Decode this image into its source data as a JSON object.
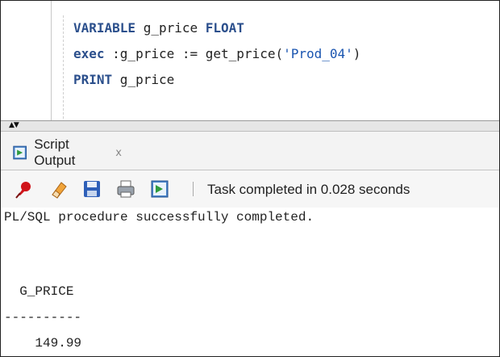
{
  "editor": {
    "line1": {
      "kw1": "VARIABLE",
      "t1": " g_price ",
      "kw2": "FLOAT"
    },
    "line2": {
      "kw1": "exec",
      "t1": " :g_price := get_price(",
      "str": "'Prod_04'",
      "t2": ")"
    },
    "line3": {
      "kw1": "PRINT",
      "t1": " g_price"
    }
  },
  "panel": {
    "tab_label": "Script Output",
    "tab_close": "x",
    "status": "Task completed in 0.028 seconds"
  },
  "output": {
    "line1": "PL/SQL procedure successfully completed.",
    "line2": "  G_PRICE",
    "line3": "----------",
    "line4": "    149.99"
  },
  "icons": {
    "toolbar": [
      "pin-icon",
      "eraser-icon",
      "save-icon",
      "print-icon",
      "script-icon"
    ]
  },
  "colors": {
    "keyword": "#2b4f8c",
    "string": "#1a55b0",
    "pin": "#d0141a",
    "save": "#2e5fb8"
  }
}
